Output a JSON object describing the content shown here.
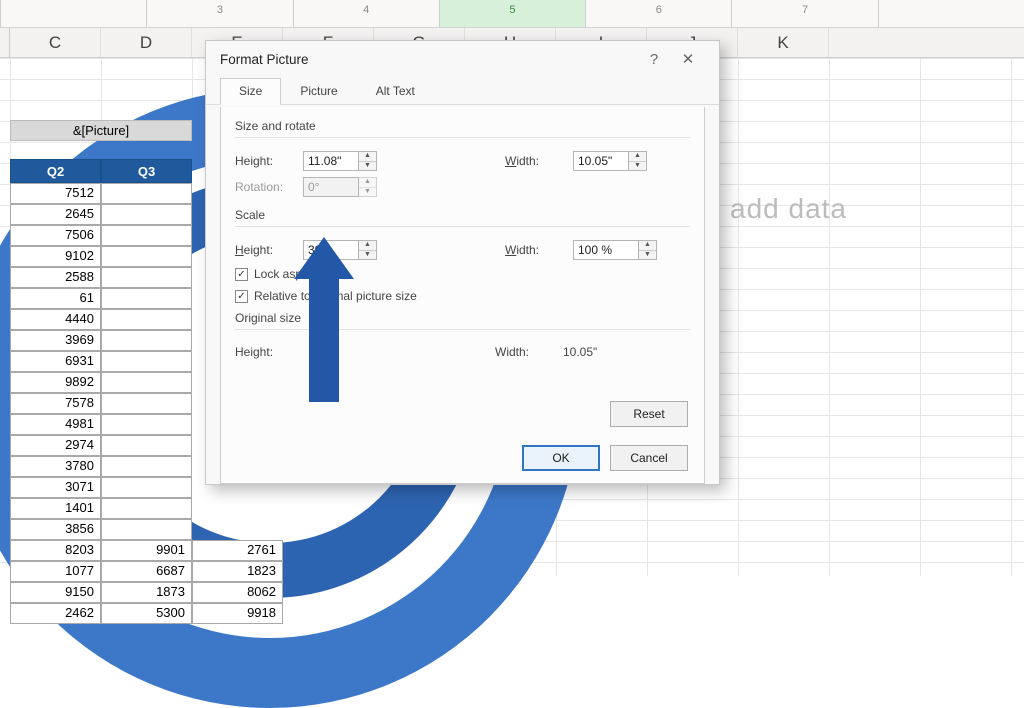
{
  "ruler": {
    "marks": [
      "",
      "3",
      "4",
      "5",
      "6",
      "7",
      ""
    ],
    "activeIndex": 3
  },
  "columns": [
    "C",
    "D",
    "E",
    "F",
    "G",
    "H",
    "I",
    "J",
    "K"
  ],
  "watermark": "add data",
  "header_placeholder": "&[Picture]",
  "quarters": [
    "Q2",
    "Q3"
  ],
  "table_rows": [
    [
      "7512",
      ""
    ],
    [
      "2645",
      ""
    ],
    [
      "7506",
      ""
    ],
    [
      "9102",
      ""
    ],
    [
      "2588",
      ""
    ],
    [
      "61",
      ""
    ],
    [
      "4440",
      ""
    ],
    [
      "3969",
      ""
    ],
    [
      "6931",
      ""
    ],
    [
      "9892",
      ""
    ],
    [
      "7578",
      ""
    ],
    [
      "4981",
      ""
    ],
    [
      "2974",
      ""
    ],
    [
      "3780",
      ""
    ],
    [
      "3071",
      ""
    ],
    [
      "1401",
      ""
    ],
    [
      "3856",
      ""
    ],
    [
      "8203",
      "9901",
      "2761"
    ],
    [
      "1077",
      "6687",
      "1823"
    ],
    [
      "9150",
      "1873",
      "8062"
    ],
    [
      "2462",
      "5300",
      "9918"
    ]
  ],
  "dialog": {
    "title": "Format Picture",
    "help_char": "?",
    "close_char": "✕",
    "tabs": {
      "size": "Size",
      "picture": "Picture",
      "alt": "Alt Text"
    },
    "size_rotate": {
      "group_label": "Size and rotate",
      "height_label": "Height:",
      "height_value": "11.08\"",
      "width_label": "Width:",
      "width_value": "10.05\"",
      "rotation_label": "Rotation:",
      "rotation_value": "0°"
    },
    "scale": {
      "group_label": "Scale",
      "height_label": "Height:",
      "height_value": "30",
      "width_label": "Width:",
      "width_value": "100 %",
      "lock_label": "Lock aspect ratio",
      "relative_label": "Relative to original picture size"
    },
    "original": {
      "group_label": "Original size",
      "height_label": "Height:",
      "height_value": "",
      "width_label": "Width:",
      "width_value": "10.05\""
    },
    "buttons": {
      "reset": "Reset",
      "ok": "OK",
      "cancel": "Cancel"
    }
  }
}
